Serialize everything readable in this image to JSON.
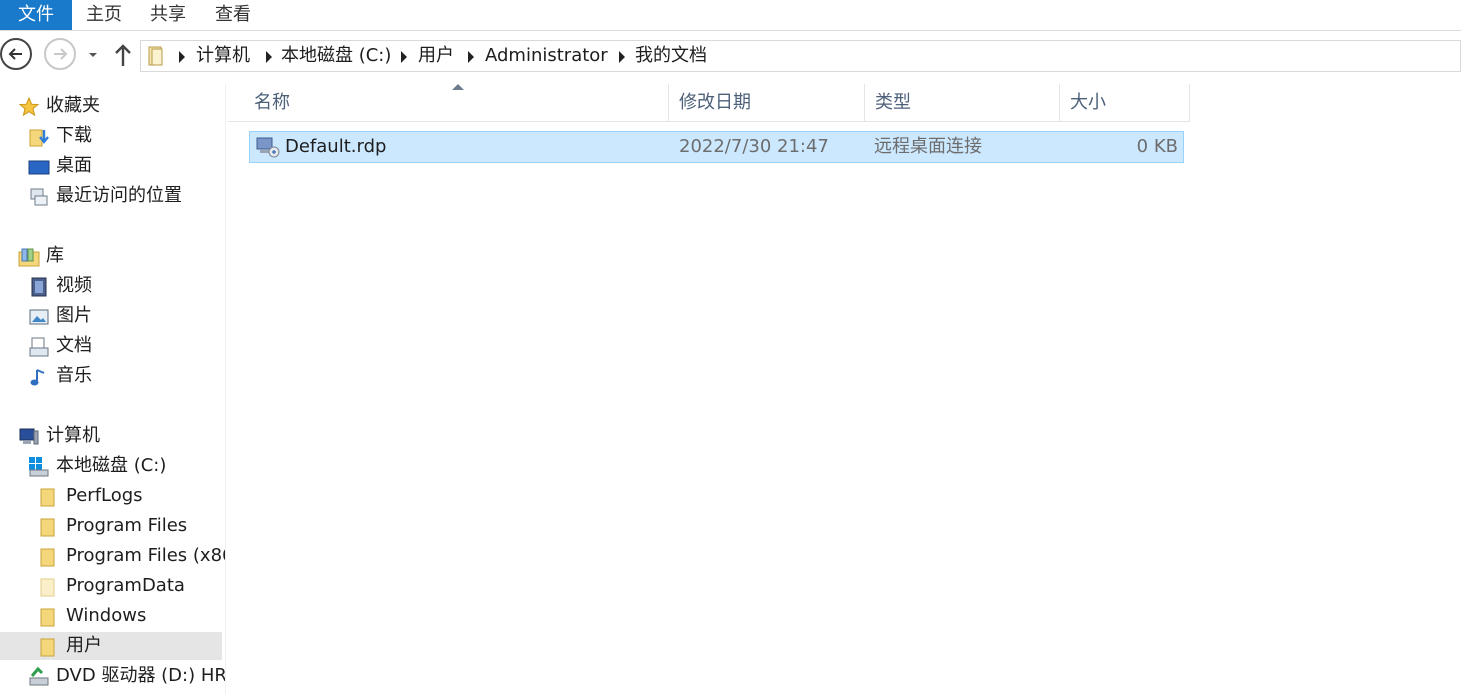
{
  "ribbon": {
    "tabs": [
      "文件",
      "主页",
      "共享",
      "查看"
    ]
  },
  "address": {
    "crumbs": [
      "计算机",
      "本地磁盘 (C:)",
      "用户",
      "Administrator",
      "我的文档"
    ]
  },
  "navpane": {
    "favorites": {
      "label": "收藏夹",
      "items": [
        "下载",
        "桌面",
        "最近访问的位置"
      ]
    },
    "libraries": {
      "label": "库",
      "items": [
        "视频",
        "图片",
        "文档",
        "音乐"
      ]
    },
    "computer": {
      "label": "计算机",
      "drive_c": "本地磁盘 (C:)",
      "folders": [
        "PerfLogs",
        "Program Files",
        "Program Files (x86",
        "ProgramData",
        "Windows",
        "用户"
      ],
      "drive_d": "DVD 驱动器 (D:) HR"
    }
  },
  "list": {
    "columns": [
      "名称",
      "修改日期",
      "类型",
      "大小"
    ],
    "rows": [
      {
        "name": "Default.rdp",
        "modified": "2022/7/30 21:47",
        "type": "远程桌面连接",
        "size": "0 KB"
      }
    ]
  },
  "colors": {
    "file_tab": "#1979ca",
    "selection_fill": "#cce8ff",
    "selection_border": "#99d1ff",
    "header_text": "#4c607a"
  }
}
